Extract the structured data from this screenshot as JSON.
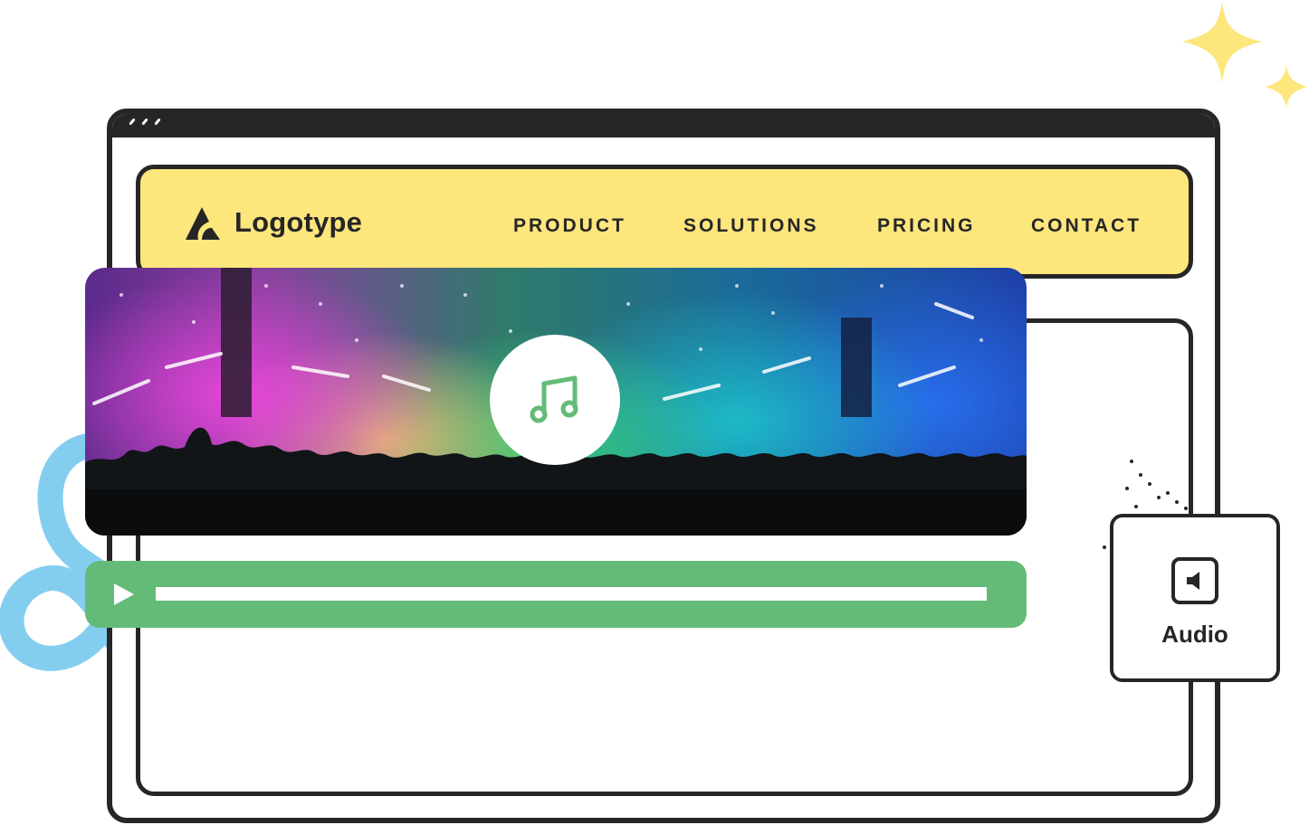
{
  "brand": {
    "name": "Logotype",
    "logo_icon": "logotype-mark-icon"
  },
  "nav": {
    "items": [
      {
        "label": "PRODUCT"
      },
      {
        "label": "SOLUTIONS"
      },
      {
        "label": "PRICING"
      },
      {
        "label": "CONTACT"
      }
    ]
  },
  "hero": {
    "image": "concert-crowd-image",
    "center_icon": "music-note-icon"
  },
  "player": {
    "play_icon": "play-icon",
    "progress": 0
  },
  "badge": {
    "icon": "speaker-icon",
    "label": "Audio"
  },
  "colors": {
    "nav_bg": "#fde67c",
    "player": "#64bb78",
    "outline": "#262626",
    "squiggle": "#7ccbee",
    "sparkle": "#fde67c"
  }
}
